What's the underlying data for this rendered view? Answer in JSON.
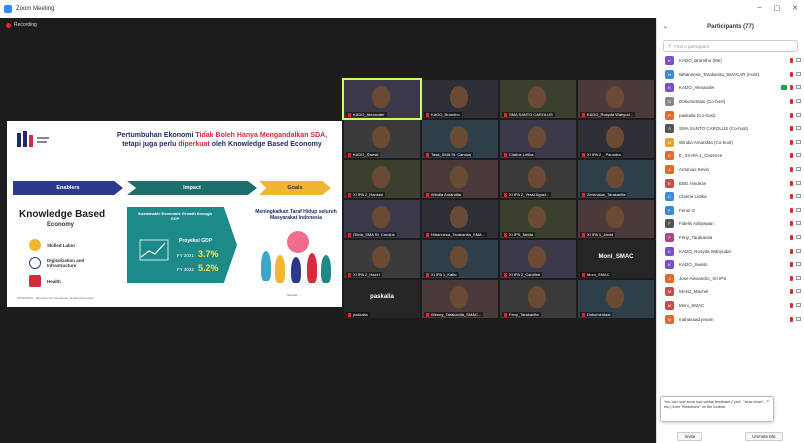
{
  "window": {
    "title": "Zoom Meeting",
    "controls": [
      "–",
      "▢",
      "✕"
    ]
  },
  "recording": {
    "label": "Recording"
  },
  "slide": {
    "headline_1": "Pertumbuhan Ekonomi ",
    "headline_red": "Tidak Boleh Hanya Mengandalkan SDA,",
    "headline_2": "tetapi juga perlu ",
    "headline_red2": "diperkuat",
    "headline_3": " oleh Knowledge Based Economy",
    "steps": [
      "Enablers",
      "Impact",
      "Goals"
    ],
    "kb_title": "Knowledge Based",
    "kb_sub": "Economy",
    "kb_items": [
      "Skilled Labor",
      "Digitalization and Infrastructure",
      "Health"
    ],
    "gdp_caption": "Sustainable Economic Growth through GDP",
    "gdp_label": "Proyeksi GDP",
    "fy2021_label": "FY 2021",
    "fy2021_value": "3.7%",
    "fy2022_label": "FY 2022",
    "fy2022_value": "5.2%",
    "goal_text": "Meningkatkan Taraf Hidup seluruh Masyarakat Indonesia",
    "footnote": "BAPPENAS · Rencana Pembangunan Jangka Menengah",
    "source": "Sumber: ..."
  },
  "tiles": [
    {
      "name": "KADO_Alexander",
      "kind": "video",
      "active": true
    },
    {
      "name": "KADO_Bramtho",
      "kind": "video"
    },
    {
      "name": "SMA SANTO CAROLUS",
      "kind": "video"
    },
    {
      "name": "KADO_Rosyda Wahyud...",
      "kind": "video"
    },
    {
      "name": "KADO_Swesti",
      "kind": "video"
    },
    {
      "name": "Tasa_SMA St. Carolus",
      "kind": "video"
    },
    {
      "name": "Clarine Letika",
      "kind": "video"
    },
    {
      "name": "XI IPA 2 _ Paundra",
      "kind": "video"
    },
    {
      "name": "XI IPA 2_Hansen",
      "kind": "video"
    },
    {
      "name": "Windia Amandita",
      "kind": "video"
    },
    {
      "name": "XI IPA 2_Yessi Agust...",
      "kind": "video"
    },
    {
      "name": "Zerenauw_Tarakanita",
      "kind": "video"
    },
    {
      "name": "Olivia_SMA St. Carolus",
      "kind": "video"
    },
    {
      "name": "Nittannesa_Tarakanita_SMA...",
      "kind": "video"
    },
    {
      "name": "XI IPS_Nelda",
      "kind": "video"
    },
    {
      "name": "XI IPA 1_Janet",
      "kind": "video"
    },
    {
      "name": "XI IPA 2_Hazel",
      "kind": "video"
    },
    {
      "name": "XI IPA 1_Kaito",
      "kind": "video"
    },
    {
      "name": "XI IPA 2_Caroline",
      "kind": "video"
    },
    {
      "name": "Moni_SMAC",
      "kind": "name",
      "bigname": "Moni_SMAC"
    },
    {
      "name": "paskalia",
      "kind": "name",
      "bigname": "paskalia"
    },
    {
      "name": "Wenny_Tarakanita_SMAC...",
      "kind": "video"
    },
    {
      "name": "Feny_Tarakanita",
      "kind": "video"
    },
    {
      "name": "Dokumentasi",
      "kind": "video"
    }
  ],
  "participants_panel": {
    "title": "Participants (77)",
    "search_placeholder": "Find a participant",
    "people": [
      {
        "name": "KADO_Bramtho (Me)",
        "color": "#7a4fc7",
        "initial": "K"
      },
      {
        "name": "Nittannesa_Tarakanita_SMACAR (Host)",
        "color": "#3b8bd6",
        "initial": "N"
      },
      {
        "name": "KADO_Alexander",
        "color": "#7a4fc7",
        "initial": "K",
        "green": true
      },
      {
        "name": "Dokumentasi (Co-host)",
        "color": "#888888",
        "initial": "D"
      },
      {
        "name": "paskalia (Co-host)",
        "color": "#e46a2b",
        "initial": "P"
      },
      {
        "name": "SMA SANTO CAROLUS (Co-host)",
        "color": "#555555",
        "initial": "S"
      },
      {
        "name": "Windia Amandita (Co-host)",
        "color": "#e8a13a",
        "initial": "W"
      },
      {
        "name": "E_XII IPA 1_Clarence",
        "color": "#e46a2b",
        "initial": "E"
      },
      {
        "name": "Antonius Kevin",
        "color": "#e46a2b",
        "initial": "A"
      },
      {
        "name": "EBG /Akdean",
        "color": "#c94b4b",
        "initial": "E"
      },
      {
        "name": "Clarine Letika",
        "color": "#3b8bd6",
        "initial": "C"
      },
      {
        "name": "Fenni G",
        "color": "#3b8bd6",
        "initial": "F"
      },
      {
        "name": "Fidelis Adityawan",
        "color": "#555555",
        "initial": "F"
      },
      {
        "name": "Feny_Tarakanita",
        "color": "#aa4a8a",
        "initial": "F"
      },
      {
        "name": "KADO_Rosyda Wahyudar",
        "color": "#7a4fc7",
        "initial": "K"
      },
      {
        "name": "KADO_Swesti",
        "color": "#7a4fc7",
        "initial": "K"
      },
      {
        "name": "Jose Alexandro_XII IPS",
        "color": "#e46a2b",
        "initial": "J"
      },
      {
        "name": "MANJ_Machel",
        "color": "#c94b4b",
        "initial": "M"
      },
      {
        "name": "Moni_SMAC",
        "color": "#c94b4b",
        "initial": "M"
      },
      {
        "name": "mahasaad.jenam",
        "color": "#e46a2b",
        "initial": "M"
      }
    ],
    "toast": "You can now send non-verbal feedback (\"yes\", \"slow down\", etc.) from \"Reactions\" on the toolbar.",
    "invite_label": "Invite",
    "mute_label": "Unmute Me"
  }
}
